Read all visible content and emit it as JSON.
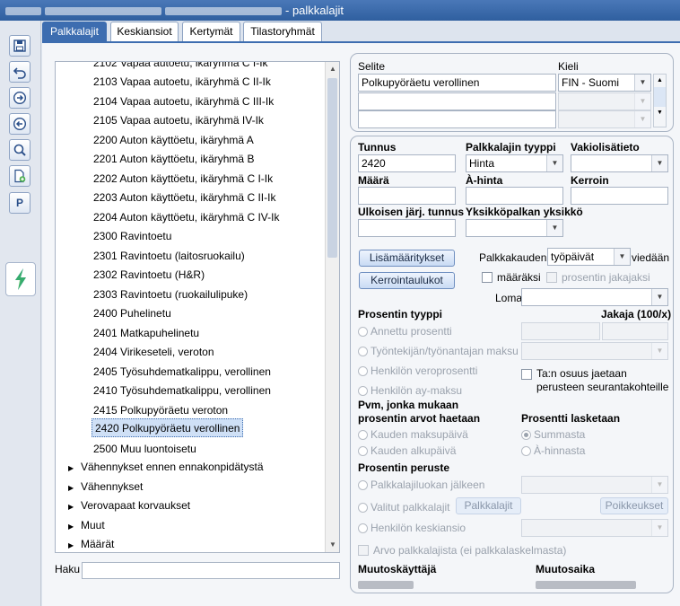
{
  "window": {
    "title": "- palkkalajit"
  },
  "tabs": [
    {
      "label": "Palkkalajit"
    },
    {
      "label": "Keskiansiot"
    },
    {
      "label": "Kertymät"
    },
    {
      "label": "Tilastoryhmät"
    }
  ],
  "toolbar": {
    "icons": [
      "save-icon",
      "undo-icon",
      "next-icon",
      "previous-icon",
      "search-icon",
      "new-document-icon"
    ],
    "p_label": "P"
  },
  "tree": {
    "partial_top": "2102 Vapaa autoetu, ikäryhmä C I-Ik",
    "items": [
      "2103 Vapaa autoetu, ikäryhmä C II-Ik",
      "2104 Vapaa autoetu, ikäryhmä C III-Ik",
      "2105 Vapaa autoetu, ikäryhmä IV-Ik",
      "2200 Auton käyttöetu, ikäryhmä A",
      "2201 Auton käyttöetu, ikäryhmä B",
      "2202 Auton käyttöetu, ikäryhmä C I-Ik",
      "2203 Auton käyttöetu, ikäryhmä C II-Ik",
      "2204 Auton käyttöetu, ikäryhmä C IV-Ik",
      "2300 Ravintoetu",
      "2301 Ravintoetu (laitosruokailu)",
      "2302 Ravintoetu (H&R)",
      "2303 Ravintoetu (ruokailulipuke)",
      "2400 Puhelinetu",
      "2401 Matkapuhelinetu",
      "2404 Virikeseteli, veroton",
      "2405 Työsuhdematkalippu, verollinen",
      "2410 Työsuhdematkalippu, verollinen",
      "2415 Polkupyöräetu veroton",
      "2420 Polkupyöräetu verollinen",
      "2500 Muu luontoisetu"
    ],
    "selected_index": 18,
    "groups": [
      "Vähennykset ennen ennakonpidätystä",
      "Vähennykset",
      "Verovapaat korvaukset",
      "Muut",
      "Määrät"
    ]
  },
  "search": {
    "label": "Haku",
    "value": ""
  },
  "selite": {
    "col1": "Selite",
    "col2": "Kieli",
    "rows": [
      {
        "selite": "Polkupyöräetu verollinen",
        "kieli": "FIN - Suomi"
      }
    ]
  },
  "form": {
    "tunnus_label": "Tunnus",
    "tunnus": "2420",
    "tyyppi_label": "Palkkalajin tyyppi",
    "tyyppi": "Hinta",
    "vakio_label": "Vakiolisätieto",
    "vakio": "",
    "maara_label": "Määrä",
    "maara": "",
    "ahinta_label": "À-hinta",
    "ahinta": "",
    "kerroin_label": "Kerroin",
    "kerroin": "",
    "ulkoinen_label": "Ulkoisen järj. tunnus",
    "ulkoinen": "",
    "yksikko_label": "Yksikköpalkan yksikkö",
    "yksikko": "",
    "lisamaaritykset": "Lisämääritykset",
    "kerrointaulukot": "Kerrointaulukot",
    "kausi_label": "Palkkakauden",
    "kausi": "työpäivät",
    "viedaan": "viedään",
    "maaraksi": "määräksi",
    "jakajaksi": "prosentin jakajaksi",
    "loma_label": "Loma",
    "loma": "",
    "prosentin_tyyppi": "Prosentin tyyppi",
    "jakaja_label": "Jakaja (100/x)",
    "tyyppi_opts": [
      "Annettu prosentti",
      "Työntekijän/työnantajan maksu",
      "Henkilön veroprosentti",
      "Henkilön ay-maksu"
    ],
    "seuranta": "Ta:n osuus jaetaan perusteen seurantakohteille",
    "seuranta_line1": "Ta:n osuus jaetaan",
    "seuranta_line2": "perusteen seurantakohteille",
    "pvm_title1": "Pvm, jonka mukaan",
    "pvm_title2": "prosentin arvot haetaan",
    "pvm_opts": [
      "Kauden maksupäivä",
      "Kauden alkupäivä"
    ],
    "laskenta_title": "Prosentti lasketaan",
    "laskenta_opts": [
      "Summasta",
      "À-hinnasta"
    ],
    "peruste_title": "Prosentin peruste",
    "peruste_opts": [
      "Palkkalajiluokan jälkeen",
      "Valitut palkkalajit",
      "Henkilön keskiansio"
    ],
    "palkkalajit_btn": "Palkkalajit",
    "poikkeukset_btn": "Poikkeukset",
    "arvo_label": "Arvo palkkalajista (ei palkkalaskelmasta)",
    "muutoskayttaja_label": "Muutoskäyttäjä",
    "muutosaika_label": "Muutosaika"
  }
}
